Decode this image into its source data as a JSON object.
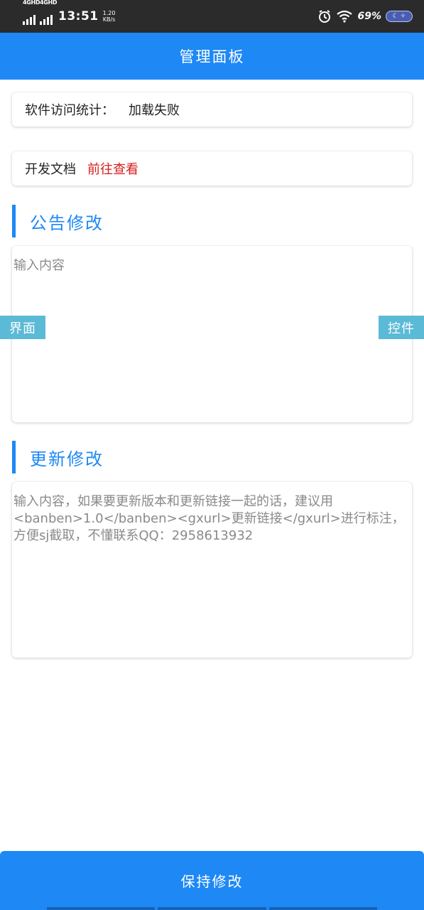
{
  "status_bar": {
    "signal_1_label": "4GHD",
    "signal_2_label": "4GHD",
    "time": "13:51",
    "speed_value": "1.20",
    "speed_unit": "KB/s",
    "battery_percent": "69%",
    "icons": [
      "alarm-icon",
      "wifi-icon",
      "battery-icon"
    ]
  },
  "app_bar": {
    "title": "管理面板"
  },
  "stats_card": {
    "label": "软件访问统计：",
    "value": "加载失败"
  },
  "docs_card": {
    "label": "开发文档",
    "link": "前往查看"
  },
  "notice_section": {
    "title": "公告修改",
    "placeholder": "输入内容"
  },
  "update_section": {
    "title": "更新修改",
    "placeholder": "输入内容，如果要更新版本和更新链接一起的话，建议用<banben>1.0</banben><gxurl>更新链接</gxurl>进行标注，方便sj截取，不懂联系QQ：2958613932"
  },
  "floating": {
    "left_label": "界面",
    "right_label": "控件"
  },
  "bottom_button": {
    "label": "保持修改"
  },
  "colors": {
    "primary": "#1e88f5",
    "link_red": "#d81b1b",
    "float_btn": "#5bbad6"
  }
}
